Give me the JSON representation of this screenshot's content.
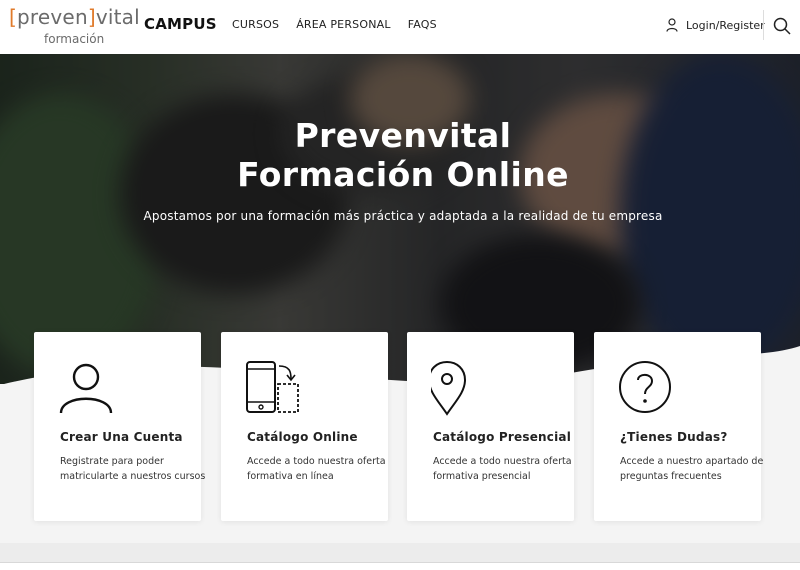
{
  "header": {
    "logo": {
      "bracket_open": "[",
      "left": "preven",
      "bracket_close": "]",
      "right": "vital",
      "sub": "formación"
    },
    "campus": "CAMPUS",
    "nav": [
      "CURSOS",
      "ÁREA PERSONAL",
      "FAQS"
    ],
    "login": "Login/Register"
  },
  "hero": {
    "title_line1": "Prevenvital",
    "title_line2": "Formación Online",
    "subtitle": "Apostamos por una formación más práctica y adaptada a la realidad de tu empresa"
  },
  "cards": [
    {
      "icon": "user-icon",
      "title": "Crear Una Cuenta",
      "desc": "Registrate para poder matricularte a nuestros cursos"
    },
    {
      "icon": "mobile-screen-icon",
      "title": "Catálogo Online",
      "desc": "Accede a todo nuestra oferta formativa en línea"
    },
    {
      "icon": "location-pin-icon",
      "title": "Catálogo Presencial",
      "desc": "Accede a todo nuestra oferta formativa presencial"
    },
    {
      "icon": "question-circle-icon",
      "title": "¿Tienes Dudas?",
      "desc": "Accede a nuestro apartado de preguntas frecuentes"
    }
  ],
  "colors": {
    "logo_accent": "#e07a2a",
    "logo_gray": "#6b6b6b"
  }
}
